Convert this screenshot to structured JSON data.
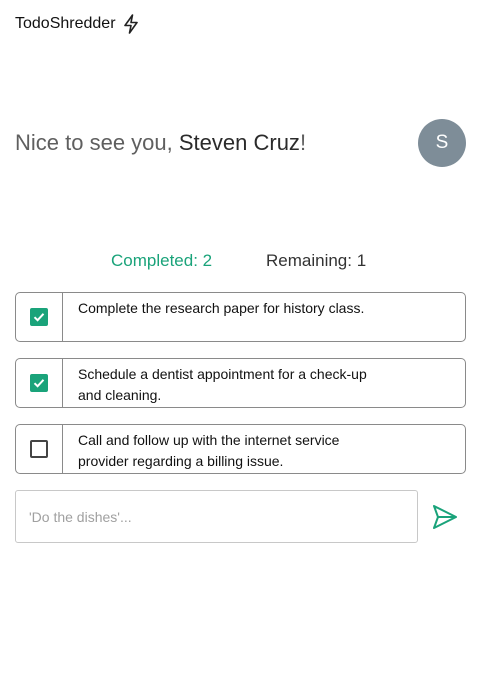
{
  "header": {
    "app_name": "TodoShredder",
    "icon": "lightning-bolt-icon"
  },
  "greeting": {
    "prefix": "Nice to see you, ",
    "name": "Steven Cruz",
    "suffix": "!"
  },
  "avatar": {
    "initial": "S",
    "color": "#7e8d98"
  },
  "stats": {
    "completed_label": "Completed: 2",
    "remaining_label": "Remaining: 1"
  },
  "todos": [
    {
      "text": "Complete the research paper for history class.",
      "done": true
    },
    {
      "text": "Schedule a dentist appointment for a check-up and cleaning.",
      "done": true
    },
    {
      "text": "Call and follow up with the internet service provider regarding a billing issue.",
      "done": false
    }
  ],
  "composer": {
    "placeholder": "'Do the dishes'...",
    "value": "",
    "send_icon": "send-icon"
  },
  "colors": {
    "accent": "#1aa37a",
    "border": "#8a8a8a"
  }
}
